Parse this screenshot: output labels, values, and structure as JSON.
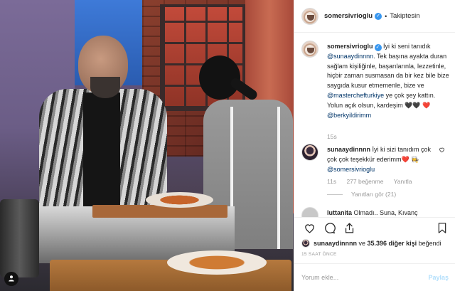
{
  "post": {
    "image_alt": "",
    "badge_icon": "user-tags-icon"
  },
  "header": {
    "username": "somersivrioglu",
    "separator": "•",
    "follow_label": "Takiptesin"
  },
  "caption": {
    "username": "somersivrioglu",
    "text_1": " İyi ki seni tanıdık ",
    "mention_1": "@sunaaydinnnn",
    "text_2": ". Tek başına ayakta duran sağlam kişiliğinle, başarılarınla, lezzetinle, hiçbir zaman susmasan da bir kez bile bize saygıda kusur etmemenle, bize ve ",
    "mention_2": "@masterchefturkiye",
    "text_3": " ye çok şey kattın. Yolun açık olsun, kardeşim 🖤🖤 ❤️ ",
    "mention_3": "@berkyildirimm",
    "time": "15s"
  },
  "reply": {
    "username": "sunaaydinnnn",
    "text_1": " İyi ki sizi tanıdım çok çok çok teşekkür ederimm❤️ ",
    "mention_1": "👩‍🍳 @somersivrioglu",
    "time": "11s",
    "likes": "277 beğenme",
    "reply_label": "Yanıtla",
    "view_replies": "Yanıtları gör (21)"
  },
  "next_comment": {
    "username": "luttanita",
    "text": " Olmadı.. Suna, Kıvanç"
  },
  "likes_line": {
    "user": "sunaaydinnnn",
    "middle": " ve ",
    "others": "35.396 diğer kişi",
    "suffix": " beğendi"
  },
  "timestamp": "15 SAAT ÖNCE",
  "comment_box": {
    "placeholder": "Yorum ekle...",
    "post_label": "Paylaş"
  },
  "colors": {
    "link": "#003569",
    "verified": "#3897f0",
    "muted": "#999999",
    "post_disabled": "#b2dffc"
  }
}
